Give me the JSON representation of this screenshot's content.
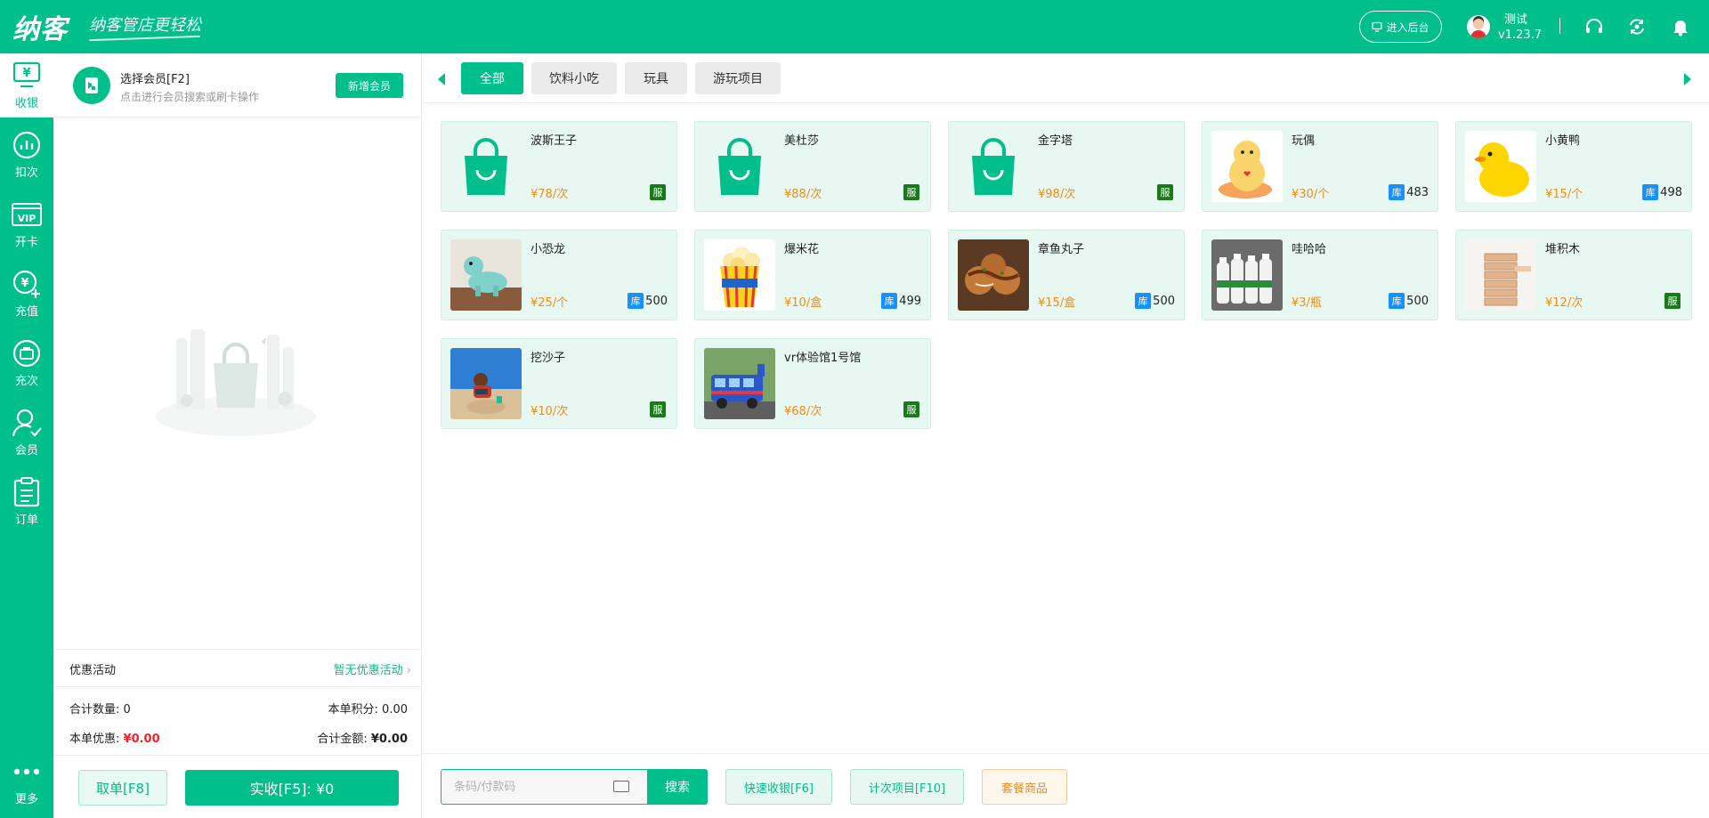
{
  "header": {
    "logo": "纳客",
    "slogan": "纳客管店更轻松",
    "backend_label": "进入后台",
    "user_name": "测试",
    "version": "v1.23.7"
  },
  "nav": [
    {
      "label": "收银",
      "icon": "cashier-icon",
      "active": true
    },
    {
      "label": "扣次",
      "icon": "deduct-icon",
      "active": false
    },
    {
      "label": "开卡",
      "icon": "vip-card-icon",
      "active": false
    },
    {
      "label": "充值",
      "icon": "recharge-icon",
      "active": false
    },
    {
      "label": "充次",
      "icon": "recharge-times-icon",
      "active": false
    },
    {
      "label": "会员",
      "icon": "member-icon",
      "active": false
    },
    {
      "label": "订单",
      "icon": "order-icon",
      "active": false
    }
  ],
  "nav_more": "更多",
  "member": {
    "title": "选择会员[F2]",
    "hint": "点击进行会员搜索或刷卡操作",
    "new_member": "新增会员"
  },
  "promo": {
    "label": "优惠活动",
    "value": "暂无优惠活动"
  },
  "summary": {
    "qty_label": "合计数量:",
    "qty_value": "0",
    "points_label": "本单积分:",
    "points_value": "0.00",
    "discount_label": "本单优惠:",
    "discount_value": "¥0.00",
    "total_label": "合计金额:",
    "total_value": "¥0.00"
  },
  "cart_footer": {
    "cancel": "取单[F8]",
    "pay": "实收[F5]: ¥0"
  },
  "tabs": [
    {
      "label": "全部",
      "active": true
    },
    {
      "label": "饮料小吃",
      "active": false
    },
    {
      "label": "玩具",
      "active": false
    },
    {
      "label": "游玩项目",
      "active": false
    }
  ],
  "products": [
    {
      "name": "波斯王子",
      "price": "¥78/次",
      "type": "service",
      "badge": "服",
      "image": "bag-icon"
    },
    {
      "name": "美杜莎",
      "price": "¥88/次",
      "type": "service",
      "badge": "服",
      "image": "bag-icon"
    },
    {
      "name": "金字塔",
      "price": "¥98/次",
      "type": "service",
      "badge": "服",
      "image": "bag-icon"
    },
    {
      "name": "玩偶",
      "price": "¥30/个",
      "type": "stock",
      "badge": "库",
      "stock": "483",
      "image": "plush-doll"
    },
    {
      "name": "小黄鸭",
      "price": "¥15/个",
      "type": "stock",
      "badge": "库",
      "stock": "498",
      "image": "rubber-duck"
    },
    {
      "name": "小恐龙",
      "price": "¥25/个",
      "type": "stock",
      "badge": "库",
      "stock": "500",
      "image": "toy-dinosaur"
    },
    {
      "name": "爆米花",
      "price": "¥10/盒",
      "type": "stock",
      "badge": "库",
      "stock": "499",
      "image": "popcorn"
    },
    {
      "name": "章鱼丸子",
      "price": "¥15/盒",
      "type": "stock",
      "badge": "库",
      "stock": "500",
      "image": "takoyaki"
    },
    {
      "name": "哇哈哈",
      "price": "¥3/瓶",
      "type": "stock",
      "badge": "库",
      "stock": "500",
      "image": "milk-bottles"
    },
    {
      "name": "堆积木",
      "price": "¥12/次",
      "type": "service",
      "badge": "服",
      "image": "wood-blocks"
    },
    {
      "name": "挖沙子",
      "price": "¥10/次",
      "type": "service",
      "badge": "服",
      "image": "sand-play"
    },
    {
      "name": "vr体验馆1号馆",
      "price": "¥68/次",
      "type": "service",
      "badge": "服",
      "image": "toy-train"
    }
  ],
  "bottom": {
    "search_placeholder": "条码/付款码",
    "search_btn": "搜索",
    "quick_cash": "快速收银[F6]",
    "times_items": "计次项目[F10]",
    "package": "套餐商品"
  },
  "colors": {
    "primary": "#00bf8a",
    "price": "#f08c1a",
    "service_badge": "#1a7a1a",
    "stock_badge": "#1890ff",
    "danger": "#f5222d"
  }
}
